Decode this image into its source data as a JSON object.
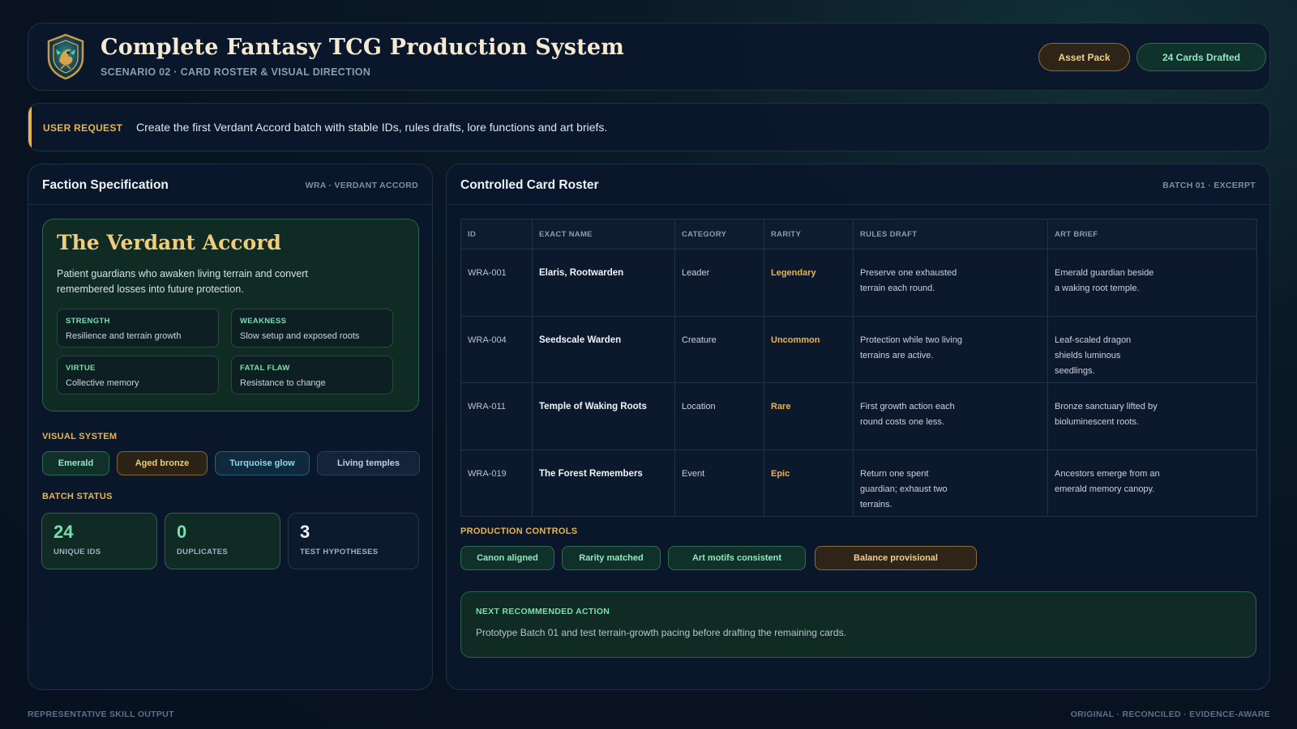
{
  "header": {
    "title": "Complete Fantasy TCG Production System",
    "subtitle": "SCENARIO 02 · CARD ROSTER & VISUAL DIRECTION",
    "logo_icon": "dragon-crest-icon",
    "asset_pack_label": "Asset Pack",
    "cards_drafted_label": "24 Cards Drafted"
  },
  "request": {
    "label": "USER REQUEST",
    "text": "Create the first Verdant Accord batch with stable IDs, rules drafts, lore functions and art briefs."
  },
  "faction_panel": {
    "title": "Faction Specification",
    "tag": "WRA · VERDANT ACCORD",
    "name": "The Verdant Accord",
    "description": "Patient guardians who awaken living terrain and convert remembered losses into future protection.",
    "traits": [
      {
        "label": "STRENGTH",
        "value": "Resilience and terrain growth"
      },
      {
        "label": "WEAKNESS",
        "value": "Slow setup and exposed roots"
      },
      {
        "label": "VIRTUE",
        "value": "Collective memory"
      },
      {
        "label": "FATAL FLAW",
        "value": "Resistance to change"
      }
    ],
    "visual_label": "VISUAL SYSTEM",
    "visual_chips": [
      "Emerald",
      "Aged bronze",
      "Turquoise glow",
      "Living temples"
    ],
    "batch_label": "BATCH STATUS",
    "stats": [
      {
        "value": "24",
        "label": "UNIQUE IDS"
      },
      {
        "value": "0",
        "label": "DUPLICATES"
      },
      {
        "value": "3",
        "label": "TEST HYPOTHESES"
      }
    ]
  },
  "roster_panel": {
    "title": "Controlled Card Roster",
    "tag": "BATCH 01 · EXCERPT",
    "columns": [
      "ID",
      "EXACT NAME",
      "CATEGORY",
      "RARITY",
      "RULES DRAFT",
      "ART BRIEF"
    ],
    "rows": [
      {
        "id": "WRA-001",
        "name": "Elaris, Rootwarden",
        "category": "Leader",
        "rarity": "Legendary",
        "rules": "Preserve one exhausted terrain each round.",
        "art": "Emerald guardian beside a waking root temple."
      },
      {
        "id": "WRA-004",
        "name": "Seedscale Warden",
        "category": "Creature",
        "rarity": "Uncommon",
        "rules": "Protection while two living terrains are active.",
        "art": "Leaf-scaled dragon shields luminous seedlings."
      },
      {
        "id": "WRA-011",
        "name": "Temple of Waking Roots",
        "category": "Location",
        "rarity": "Rare",
        "rules": "First growth action each round costs one less.",
        "art": "Bronze sanctuary lifted by bioluminescent roots."
      },
      {
        "id": "WRA-019",
        "name": "The Forest Remembers",
        "category": "Event",
        "rarity": "Epic",
        "rules": "Return one spent guardian; exhaust two terrains.",
        "art": "Ancestors emerge from an emerald memory canopy."
      }
    ],
    "controls_label": "PRODUCTION CONTROLS",
    "controls": [
      "Canon aligned",
      "Rarity matched",
      "Art motifs consistent",
      "Balance provisional"
    ],
    "next_action": {
      "label": "NEXT RECOMMENDED ACTION",
      "text": "Prototype Batch 01 and test terrain-growth pacing before drafting the remaining cards."
    }
  },
  "footer": {
    "left": "REPRESENTATIVE SKILL OUTPUT",
    "right": "ORIGINAL · RECONCILED · EVIDENCE-AWARE"
  },
  "colors": {
    "accent_gold": "#e6b54f",
    "accent_green": "#79dfae",
    "panel_bg": "#0b172b",
    "faction_bg": "#0f2b24"
  }
}
